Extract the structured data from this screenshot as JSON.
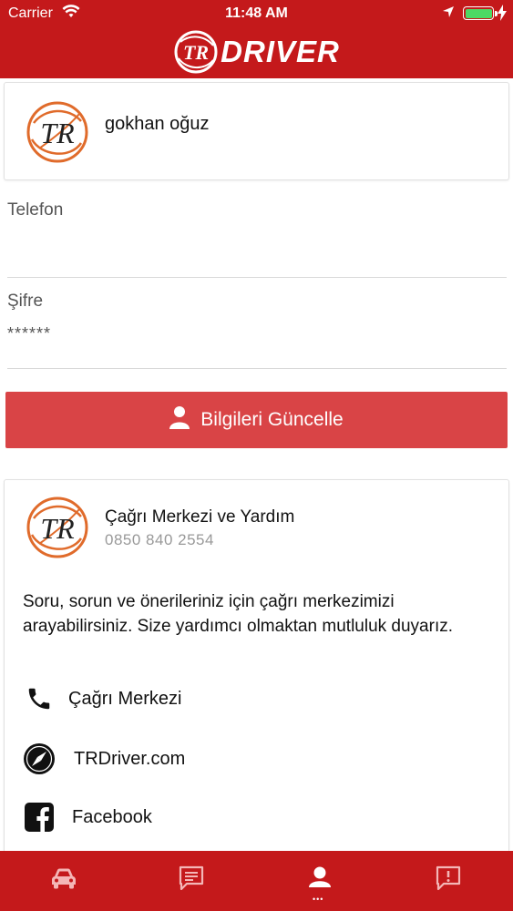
{
  "status_bar": {
    "carrier": "Carrier",
    "time": "11:48 AM"
  },
  "header": {
    "brand_text": "DRIVER",
    "brand_logo_letters": "TR",
    "accent_color": "#c4191b"
  },
  "profile": {
    "name": "gokhan oğuz",
    "avatar_logo_letters": "TR"
  },
  "form": {
    "phone_label": "Telefon",
    "phone_value": "",
    "password_label": "Şifre",
    "password_value": "******",
    "update_button_label": "Bilgileri Güncelle",
    "update_button_color": "#d94446"
  },
  "help": {
    "logo_letters": "TR",
    "title": "Çağrı Merkezi ve Yardım",
    "phone_number": "0850 840 2554",
    "description": "Soru, sorun ve önerileriniz için çağrı merkezimizi arayabilirsiniz. Size yardımcı olmaktan mutluluk duyarız.",
    "links": [
      {
        "label": "Çağrı Merkezi",
        "icon": "phone-icon"
      },
      {
        "label": "TRDriver.com",
        "icon": "compass-icon"
      },
      {
        "label": "Facebook",
        "icon": "facebook-icon"
      }
    ]
  },
  "tabbar": {
    "tabs": [
      {
        "icon": "car-icon",
        "active": false
      },
      {
        "icon": "messages-icon",
        "active": false
      },
      {
        "icon": "profile-icon",
        "active": true
      },
      {
        "icon": "report-icon",
        "active": false
      }
    ]
  }
}
